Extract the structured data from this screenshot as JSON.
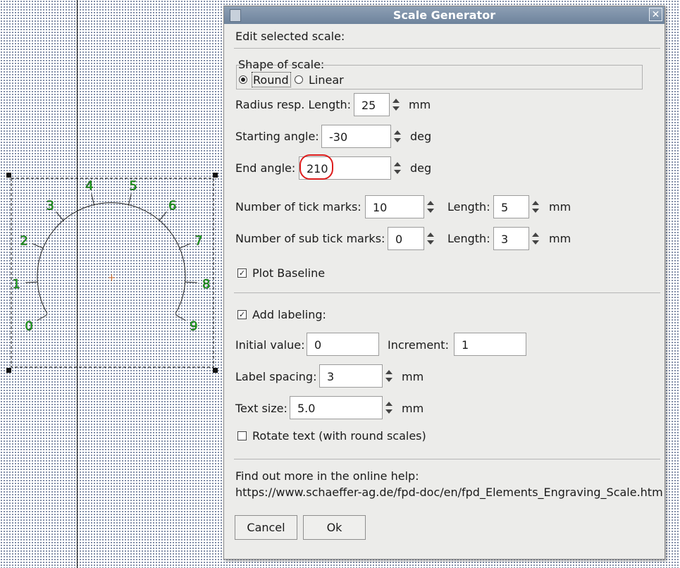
{
  "canvas": {
    "scale_labels": [
      "0",
      "1",
      "2",
      "3",
      "4",
      "5",
      "6",
      "7",
      "8",
      "9"
    ]
  },
  "dialog": {
    "title": "Scale Generator",
    "close_glyph": "✕",
    "header": "Edit selected scale:",
    "shape": {
      "legend": "Shape of scale:",
      "round_label": "Round",
      "linear_label": "Linear",
      "selected": "Round"
    },
    "radius": {
      "label": "Radius resp. Length:",
      "value": "25",
      "unit": "mm"
    },
    "start_angle": {
      "label": "Starting angle:",
      "value": "-30",
      "unit": "deg"
    },
    "end_angle": {
      "label": "End angle:",
      "value": "210",
      "unit": "deg"
    },
    "ticks": {
      "label": "Number of tick marks:",
      "value": "10",
      "length_label": "Length:",
      "length_value": "5",
      "unit": "mm"
    },
    "sub_ticks": {
      "label": "Number of sub tick marks:",
      "value": "0",
      "length_label": "Length:",
      "length_value": "3",
      "unit": "mm"
    },
    "plot_baseline": {
      "label": "Plot Baseline",
      "checked": true,
      "glyph": "✓"
    },
    "add_labeling": {
      "label": "Add labeling:",
      "checked": true,
      "glyph": "✓"
    },
    "initial_value": {
      "label": "Initial value:",
      "value": "0"
    },
    "increment": {
      "label": "Increment:",
      "value": "1"
    },
    "label_spacing": {
      "label": "Label spacing:",
      "value": "3",
      "unit": "mm"
    },
    "text_size": {
      "label": "Text size:",
      "value": "5.0",
      "unit": "mm"
    },
    "rotate_text": {
      "label": "Rotate text (with round scales)",
      "checked": false
    },
    "help": {
      "text": "Find out more in the online help:",
      "url": "https://www.schaeffer-ag.de/fpd-doc/en/fpd_Elements_Engraving_Scale.htm"
    },
    "buttons": {
      "cancel": "Cancel",
      "ok": "Ok"
    }
  },
  "colors": {
    "label_green": "#1fcc1f",
    "annotation_red": "#dd1d1d",
    "titlebar": "#7b8fa7"
  }
}
